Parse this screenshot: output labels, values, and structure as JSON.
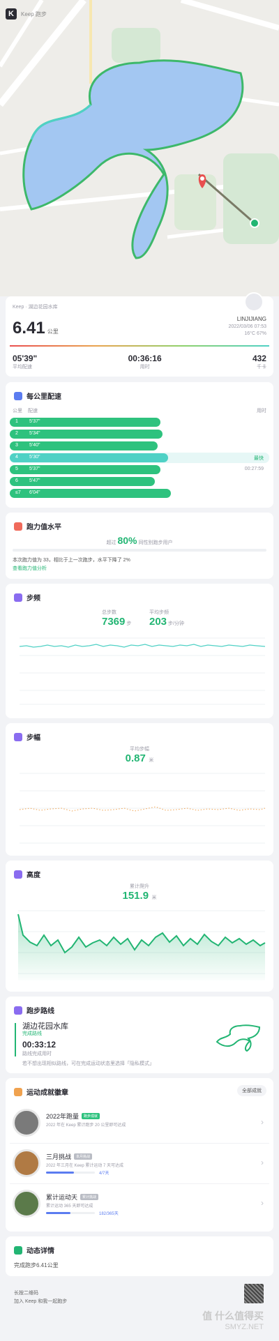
{
  "app": {
    "logo_letter": "K",
    "watermark": "Keep 跑步"
  },
  "summary": {
    "route_crumb": "Keep · 湖边花园水库",
    "distance": "6.41",
    "distance_unit": "公里",
    "user": "LINJIJIANG",
    "datetime": "2022/03/06 07:53",
    "weather": "16°C   67%",
    "stats": [
      {
        "value": "05'39\"",
        "label": "平均配速"
      },
      {
        "value": "00:36:16",
        "label": "用时"
      },
      {
        "value": "432",
        "label": "千卡"
      }
    ]
  },
  "pace": {
    "title": "每公里配速",
    "col_km": "公里",
    "col_pace": "配速",
    "col_time": "用时",
    "fastest_label": "最快",
    "rows": [
      {
        "km": "1",
        "pace": "5'37\"",
        "fraction": 0.58
      },
      {
        "km": "2",
        "pace": "5'34\"",
        "fraction": 0.59
      },
      {
        "km": "3",
        "pace": "5'40\"",
        "fraction": 0.57
      },
      {
        "km": "4",
        "pace": "5'30\"",
        "fraction": 0.61,
        "fastest": true
      },
      {
        "km": "5",
        "pace": "5'37\"",
        "fraction": 0.58,
        "time": "00:27:59"
      },
      {
        "km": "6",
        "pace": "5'47\"",
        "fraction": 0.56
      },
      {
        "km": "≤7",
        "pace": "6'04\"",
        "fraction": 0.62
      }
    ]
  },
  "ability": {
    "title": "跑力值水平",
    "beat_prefix": "超过",
    "beat_pct": "80%",
    "beat_suffix": "同性别跑步用户",
    "desc": "本次跑力值为 33，相比于上一次跑步，水平下降了 2%",
    "link": "查看跑力值分析"
  },
  "cadence": {
    "title": "步频",
    "total_label": "总步数",
    "total": "7369",
    "total_unit": "步",
    "avg_label": "平均步频",
    "avg": "203",
    "avg_unit": "步/分钟"
  },
  "stride": {
    "title": "步幅",
    "avg_label": "平均步幅",
    "avg": "0.87",
    "avg_unit": "米"
  },
  "elevation": {
    "title": "高度",
    "gain_label": "累计爬升",
    "gain": "151.9",
    "gain_unit": "米"
  },
  "route": {
    "title": "跑步路线",
    "name": "湖边花园水库",
    "sub": "完成路线",
    "time": "00:33:12",
    "time_label": "路线完成用时",
    "desc": "若不想出现相似路线，可在完成运动状态里选择「隐私模式」"
  },
  "badges": {
    "title": "运动成就徽章",
    "all_button": "全部成就",
    "items": [
      {
        "name": "2022年跑量",
        "tag": "跑步成就",
        "desc": "2022 年在 Keep 累计跑步 20 公里即可达成",
        "progress": null,
        "count": ""
      },
      {
        "name": "三月挑战",
        "tag": "本月挑战",
        "desc": "2022 年三月在 Keep 累计运动 7 天可达成",
        "progress": 0.57,
        "count": "4/7天"
      },
      {
        "name": "累计运动天",
        "tag": "累计挑战",
        "desc": "累计运动 365 天即可达成",
        "progress": 0.5,
        "count": "182/365天"
      }
    ]
  },
  "moments": {
    "title": "动态详情",
    "text": "完成跑步6.41公里"
  },
  "footer": {
    "line1": "长按二维码",
    "line2": "加入 Keep 和我一起跑步",
    "site": "SMYZ.NET",
    "brand": "值 什么值得买"
  },
  "colors": {
    "accent": "#22b573",
    "teal": "#4fd1c5",
    "lake": "#9ec3f2",
    "route": "#3db86a"
  }
}
